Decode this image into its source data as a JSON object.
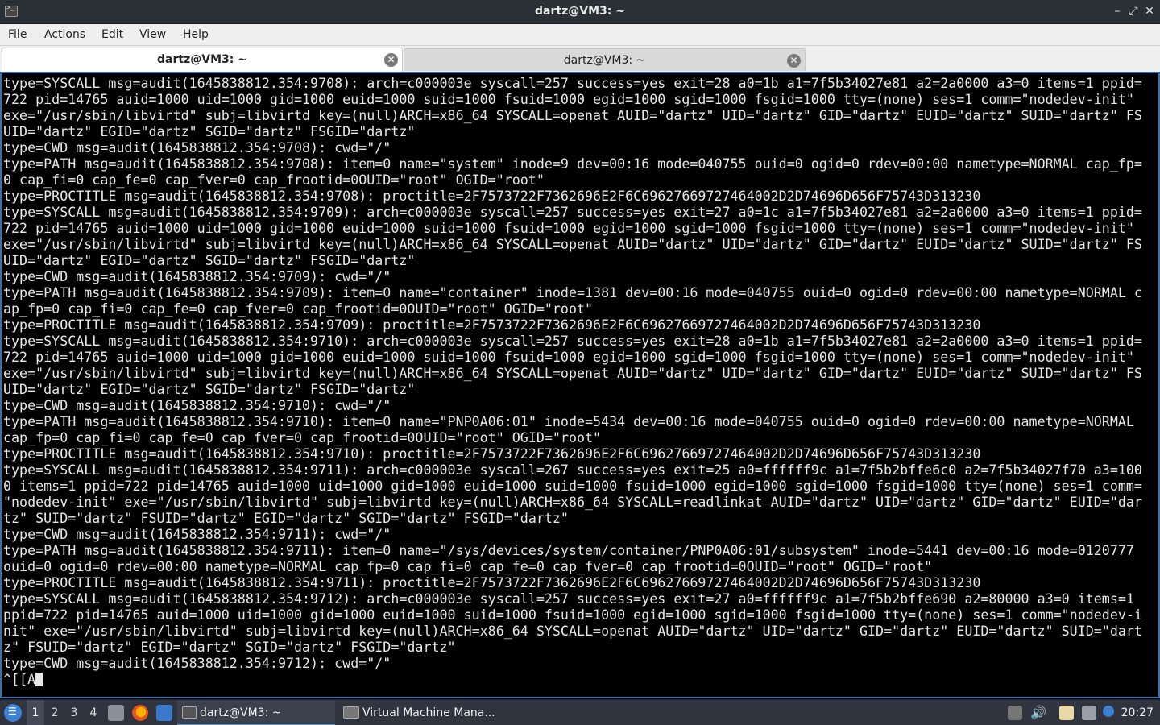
{
  "window": {
    "title": "dartz@VM3: ~",
    "minimize_glyph": "–",
    "maximize_glyph": "⤢",
    "close_glyph": "✕"
  },
  "menu": [
    "File",
    "Actions",
    "Edit",
    "View",
    "Help"
  ],
  "tabs": [
    {
      "label": "dartz@VM3: ~",
      "active": true
    },
    {
      "label": "dartz@VM3: ~",
      "active": false
    }
  ],
  "terminal": {
    "lines": [
      "type=SYSCALL msg=audit(1645838812.354:9708): arch=c000003e syscall=257 success=yes exit=28 a0=1b a1=7f5b34027e81 a2=2a0000 a3=0 items=1 ppid=",
      "722 pid=14765 auid=1000 uid=1000 gid=1000 euid=1000 suid=1000 fsuid=1000 egid=1000 sgid=1000 fsgid=1000 tty=(none) ses=1 comm=\"nodedev-init\"",
      "exe=\"/usr/sbin/libvirtd\" subj=libvirtd key=(null)ARCH=x86_64 SYSCALL=openat AUID=\"dartz\" UID=\"dartz\" GID=\"dartz\" EUID=\"dartz\" SUID=\"dartz\" FS",
      "UID=\"dartz\" EGID=\"dartz\" SGID=\"dartz\" FSGID=\"dartz\"",
      "type=CWD msg=audit(1645838812.354:9708): cwd=\"/\"",
      "type=PATH msg=audit(1645838812.354:9708): item=0 name=\"system\" inode=9 dev=00:16 mode=040755 ouid=0 ogid=0 rdev=00:00 nametype=NORMAL cap_fp=",
      "0 cap_fi=0 cap_fe=0 cap_fver=0 cap_frootid=0OUID=\"root\" OGID=\"root\"",
      "type=PROCTITLE msg=audit(1645838812.354:9708): proctitle=2F7573722F7362696E2F6C69627669727464002D2D74696D656F75743D313230",
      "type=SYSCALL msg=audit(1645838812.354:9709): arch=c000003e syscall=257 success=yes exit=27 a0=1c a1=7f5b34027e81 a2=2a0000 a3=0 items=1 ppid=",
      "722 pid=14765 auid=1000 uid=1000 gid=1000 euid=1000 suid=1000 fsuid=1000 egid=1000 sgid=1000 fsgid=1000 tty=(none) ses=1 comm=\"nodedev-init\"",
      "exe=\"/usr/sbin/libvirtd\" subj=libvirtd key=(null)ARCH=x86_64 SYSCALL=openat AUID=\"dartz\" UID=\"dartz\" GID=\"dartz\" EUID=\"dartz\" SUID=\"dartz\" FS",
      "UID=\"dartz\" EGID=\"dartz\" SGID=\"dartz\" FSGID=\"dartz\"",
      "type=CWD msg=audit(1645838812.354:9709): cwd=\"/\"",
      "type=PATH msg=audit(1645838812.354:9709): item=0 name=\"container\" inode=1381 dev=00:16 mode=040755 ouid=0 ogid=0 rdev=00:00 nametype=NORMAL c",
      "ap_fp=0 cap_fi=0 cap_fe=0 cap_fver=0 cap_frootid=0OUID=\"root\" OGID=\"root\"",
      "type=PROCTITLE msg=audit(1645838812.354:9709): proctitle=2F7573722F7362696E2F6C69627669727464002D2D74696D656F75743D313230",
      "type=SYSCALL msg=audit(1645838812.354:9710): arch=c000003e syscall=257 success=yes exit=28 a0=1b a1=7f5b34027e81 a2=2a0000 a3=0 items=1 ppid=",
      "722 pid=14765 auid=1000 uid=1000 gid=1000 euid=1000 suid=1000 fsuid=1000 egid=1000 sgid=1000 fsgid=1000 tty=(none) ses=1 comm=\"nodedev-init\"",
      "exe=\"/usr/sbin/libvirtd\" subj=libvirtd key=(null)ARCH=x86_64 SYSCALL=openat AUID=\"dartz\" UID=\"dartz\" GID=\"dartz\" EUID=\"dartz\" SUID=\"dartz\" FS",
      "UID=\"dartz\" EGID=\"dartz\" SGID=\"dartz\" FSGID=\"dartz\"",
      "type=CWD msg=audit(1645838812.354:9710): cwd=\"/\"",
      "type=PATH msg=audit(1645838812.354:9710): item=0 name=\"PNP0A06:01\" inode=5434 dev=00:16 mode=040755 ouid=0 ogid=0 rdev=00:00 nametype=NORMAL",
      "cap_fp=0 cap_fi=0 cap_fe=0 cap_fver=0 cap_frootid=0OUID=\"root\" OGID=\"root\"",
      "type=PROCTITLE msg=audit(1645838812.354:9710): proctitle=2F7573722F7362696E2F6C69627669727464002D2D74696D656F75743D313230",
      "type=SYSCALL msg=audit(1645838812.354:9711): arch=c000003e syscall=267 success=yes exit=25 a0=ffffff9c a1=7f5b2bffe6c0 a2=7f5b34027f70 a3=100",
      "0 items=1 ppid=722 pid=14765 auid=1000 uid=1000 gid=1000 euid=1000 suid=1000 fsuid=1000 egid=1000 sgid=1000 fsgid=1000 tty=(none) ses=1 comm=",
      "\"nodedev-init\" exe=\"/usr/sbin/libvirtd\" subj=libvirtd key=(null)ARCH=x86_64 SYSCALL=readlinkat AUID=\"dartz\" UID=\"dartz\" GID=\"dartz\" EUID=\"dar",
      "tz\" SUID=\"dartz\" FSUID=\"dartz\" EGID=\"dartz\" SGID=\"dartz\" FSGID=\"dartz\"",
      "type=CWD msg=audit(1645838812.354:9711): cwd=\"/\"",
      "type=PATH msg=audit(1645838812.354:9711): item=0 name=\"/sys/devices/system/container/PNP0A06:01/subsystem\" inode=5441 dev=00:16 mode=0120777",
      "ouid=0 ogid=0 rdev=00:00 nametype=NORMAL cap_fp=0 cap_fi=0 cap_fe=0 cap_fver=0 cap_frootid=0OUID=\"root\" OGID=\"root\"",
      "type=PROCTITLE msg=audit(1645838812.354:9711): proctitle=2F7573722F7362696E2F6C69627669727464002D2D74696D656F75743D313230",
      "type=SYSCALL msg=audit(1645838812.354:9712): arch=c000003e syscall=257 success=yes exit=27 a0=ffffff9c a1=7f5b2bffe690 a2=80000 a3=0 items=1",
      "ppid=722 pid=14765 auid=1000 uid=1000 gid=1000 euid=1000 suid=1000 fsuid=1000 egid=1000 sgid=1000 fsgid=1000 tty=(none) ses=1 comm=\"nodedev-i",
      "nit\" exe=\"/usr/sbin/libvirtd\" subj=libvirtd key=(null)ARCH=x86_64 SYSCALL=openat AUID=\"dartz\" UID=\"dartz\" GID=\"dartz\" EUID=\"dartz\" SUID=\"dart",
      "z\" FSUID=\"dartz\" EGID=\"dartz\" SGID=\"dartz\" FSGID=\"dartz\"",
      "type=CWD msg=audit(1645838812.354:9712): cwd=\"/\""
    ],
    "prompt_input": "^[[A"
  },
  "taskbar": {
    "workspaces": [
      "1",
      "2",
      "3",
      "4"
    ],
    "active_workspace": "1",
    "tasks": [
      {
        "label": "dartz@VM3: ~",
        "active": true,
        "icon": "terminal-icon"
      },
      {
        "label": "Virtual Machine Mana...",
        "active": false,
        "icon": "virt-manager-icon"
      }
    ],
    "clock": "20:27"
  },
  "colors": {
    "terminal_bg": "#000000",
    "terminal_fg": "#e6e6e6",
    "accent": "#3c6fb0",
    "taskbar_bg": "#2f343f"
  }
}
